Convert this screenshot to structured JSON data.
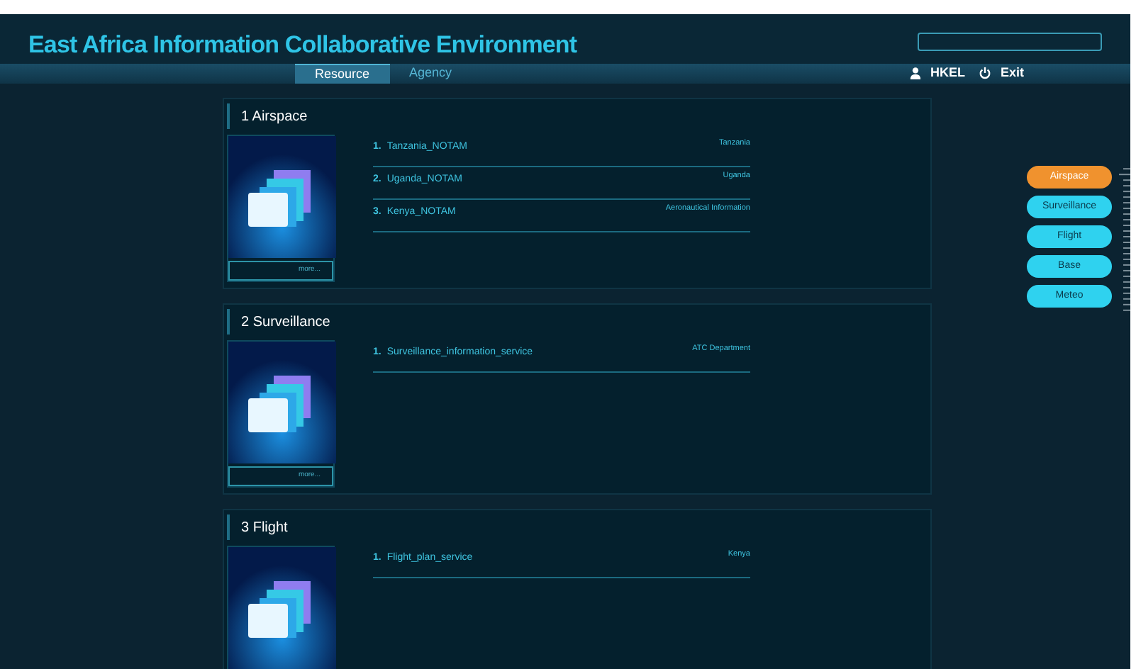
{
  "header": {
    "title": "East Africa Information Collaborative Environment"
  },
  "nav": {
    "tabs": [
      {
        "label": "Resource",
        "selected": true
      },
      {
        "label": "Agency",
        "selected": false
      }
    ],
    "user": "HKEL",
    "exit": "Exit"
  },
  "sections": [
    {
      "title": "1 Airspace",
      "more": "more...",
      "items": [
        {
          "number": "1.",
          "name": "Tanzania_NOTAM",
          "source": "Tanzania"
        },
        {
          "number": "2.",
          "name": "Uganda_NOTAM",
          "source": "Uganda"
        },
        {
          "number": "3.",
          "name": "Kenya_NOTAM",
          "source": "Aeronautical Information"
        }
      ]
    },
    {
      "title": "2 Surveillance",
      "more": "more...",
      "items": [
        {
          "number": "1.",
          "name": "Surveillance_information_service",
          "source": "ATC Department"
        }
      ]
    },
    {
      "title": "3 Flight",
      "items": [
        {
          "number": "1.",
          "name": "Flight_plan_service",
          "source": "Kenya"
        }
      ]
    }
  ],
  "side_nav": [
    {
      "label": "Airspace",
      "selected": true
    },
    {
      "label": "Surveillance",
      "selected": false
    },
    {
      "label": "Flight",
      "selected": false
    },
    {
      "label": "Base",
      "selected": false
    },
    {
      "label": "Meteo",
      "selected": false
    }
  ]
}
